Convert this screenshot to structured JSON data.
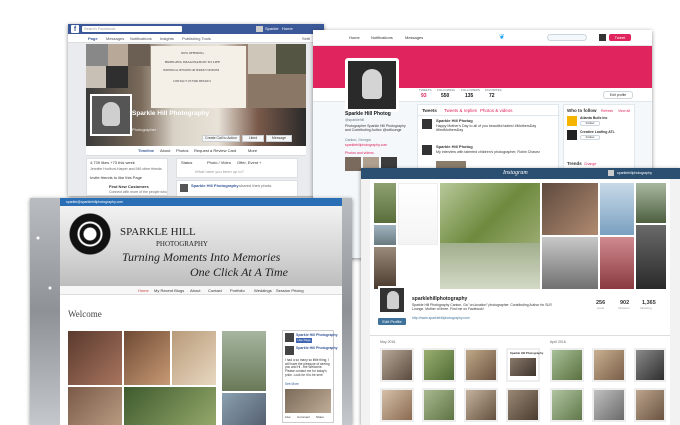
{
  "facebook": {
    "search_placeholder": "Search Facebook",
    "user_name": "Sparkle",
    "home_label": "Home",
    "nav": [
      "Page",
      "Messages",
      "Notifications",
      "Insights",
      "Publishing Tools"
    ],
    "settings_label": "Setti",
    "cover_lines": [
      "NOW OFFERING:",
      "BRINGING IMAGINATION TO LIFE",
      "INDIVIDUAL SESSIONS OR SERIOUS SESSIONS",
      "CONTACT US FOR DETAILS"
    ],
    "page_name": "Sparkle Hill Photography",
    "page_category": "Photographer",
    "call_to_action": "Create Call to Action",
    "liked_label": "Liked",
    "message_label": "Message",
    "tabs": [
      "Timeline",
      "About",
      "Photos",
      "Request a Review Card",
      "More"
    ],
    "left_col": [
      "4,739 likes +73 this week",
      "Jennifer Hurlburt-Harper and 949 other friends",
      "Invite friends to like this Page",
      "Find New Customers",
      "Connect with more of the people who"
    ],
    "composer_tabs": [
      "Status",
      "Photo / Video",
      "Offer, Event +"
    ],
    "composer_placeholder": "What have you been up to?",
    "post_author": "Sparkle Hill Photography",
    "post_meta": "shared their photo."
  },
  "twitter": {
    "nav": [
      "Home",
      "Notifications",
      "Messages"
    ],
    "tweet_button": "Tweet",
    "stats": [
      {
        "label": "TWEETS",
        "value": "93"
      },
      {
        "label": "FOLLOWING",
        "value": "550"
      },
      {
        "label": "FOLLOWERS",
        "value": "135"
      },
      {
        "label": "FAVORITES",
        "value": "72"
      }
    ],
    "edit_profile": "Edit profile",
    "name": "Sparkle Hill Photog",
    "handle": "@sparklehill",
    "bio": "Photographer Sparkle Hill Photography and Contributing Author @sdtlounge",
    "location": "Canton, Georgia",
    "website": "sparklehillphotography.com",
    "photos_link": "Photos and videos",
    "tabs": [
      "Tweets",
      "Tweets & replies",
      "Photos & videos"
    ],
    "tweet1_author": "Sparkle Hill Photog",
    "tweet1_text": "Happy Mother's Day to all of you beautiful ladies! #MothersDay #firstMothersDay",
    "tweet2_author": "Sparkle Hill Photog",
    "tweet2_text": "My interview with talented children's photographer, Robin Chavez",
    "who_to_follow": "Who to follow",
    "refresh": "Refresh",
    "view_all": "View all",
    "suggestions": [
      "Atlanta Bulls Inc",
      "Creative Loafing ATL"
    ],
    "follow_label": "Follow",
    "trends": "Trends",
    "change": "Change"
  },
  "website": {
    "email": "sparkle@sparklehillphotography.com",
    "logo_line1": "SPARKLE HILL",
    "logo_line2": "PHOTOGRAPHY",
    "tagline1": "Turning Moments Into Memories",
    "tagline2": "One Click At A Time",
    "nav": [
      "Home",
      "My Recent Blogs",
      "About",
      "Contact",
      "Portfolio",
      "Weddings",
      "Session Pricing"
    ],
    "welcome": "Welcome",
    "widget_title": "Sparkle Hill Photography",
    "widget_like": "Like Page",
    "widget_author": "Sparkle Hill Photography",
    "widget_text": "I had a so many so little thing, I will have the pleasure of seeing you and Hi - the Welcome. Please contact me for today's price. Look for it to be sent",
    "widget_see_more": "See More",
    "widget_actions": [
      "Like",
      "Comment",
      "Share"
    ]
  },
  "instagram": {
    "logo": "Instagram",
    "user": "sparklehillphotography",
    "edit_profile": "Edit Profile",
    "username": "sparklehillphotography",
    "bio": "Sparkle Hill Photography Canton, Ga \"on-location\" photographer. Contributing Author for SLR Lounge. Mother of three. Find me on Facebook!",
    "website": "http://www.sparklehillphotography.com",
    "stats": [
      {
        "label": "posts",
        "value": "256"
      },
      {
        "label": "followers",
        "value": "902"
      },
      {
        "label": "following",
        "value": "1,365"
      }
    ],
    "months": [
      "May 2016",
      "April 2016"
    ],
    "post_card_title": "Sparkle Hill Photography"
  }
}
